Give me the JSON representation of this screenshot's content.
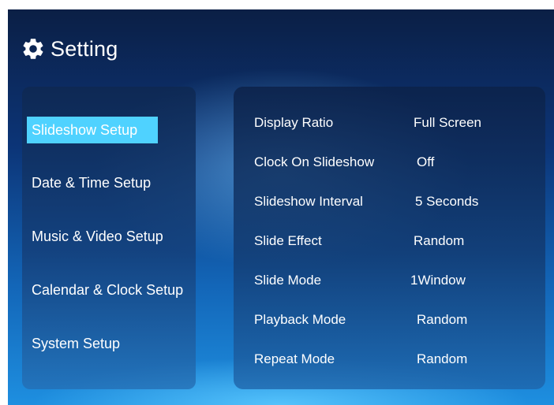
{
  "header": {
    "title": "Setting",
    "icon": "gear-icon"
  },
  "menu": {
    "items": [
      {
        "label": "Slideshow Setup",
        "selected": true
      },
      {
        "label": "Date & Time Setup",
        "selected": false
      },
      {
        "label": "Music & Video Setup",
        "selected": false
      },
      {
        "label": "Calendar & Clock Setup",
        "selected": false
      },
      {
        "label": "System Setup",
        "selected": false
      }
    ]
  },
  "settings": {
    "rows": [
      {
        "label": "Display Ratio",
        "value": "Full Screen"
      },
      {
        "label": "Clock On Slideshow",
        "value": "Off"
      },
      {
        "label": "Slideshow Interval",
        "value": "5 Seconds"
      },
      {
        "label": "Slide Effect",
        "value": "Random"
      },
      {
        "label": "Slide Mode",
        "value": "1Window"
      },
      {
        "label": "Playback Mode",
        "value": "Random"
      },
      {
        "label": "Repeat Mode",
        "value": "Random"
      }
    ]
  },
  "colors": {
    "selected_highlight": "#4fd2ff",
    "text": "#ffffff"
  }
}
